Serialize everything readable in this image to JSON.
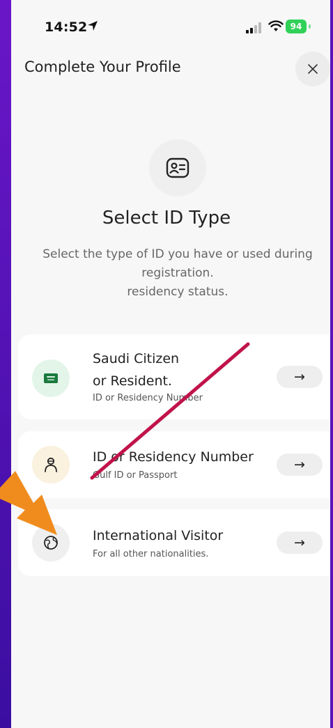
{
  "status_bar": {
    "time": "14:52",
    "battery": "94"
  },
  "header": {
    "title": "Complete Your Profile",
    "close_symbol": "✕"
  },
  "hero": {
    "title": "Select ID Type",
    "description_lines": [
      "Select the type of ID you have or used during",
      "registration.",
      "residency status."
    ]
  },
  "options": [
    {
      "title_line1": "Saudi Citizen",
      "title_line2": "or Resident.",
      "subtitle": "ID or Residency Number",
      "icon": "saudi-flag-icon",
      "arrow": "→"
    },
    {
      "title": "ID or Residency Number",
      "subtitle": "Gulf ID or Passport",
      "icon": "person-icon",
      "arrow": "→"
    },
    {
      "title": "International Visitor",
      "subtitle": "For all other nationalities.",
      "icon": "globe-icon",
      "arrow": "→"
    }
  ],
  "colors": {
    "accent_bg": "#4a12b0",
    "annotation_line": "#c0134a",
    "annotation_arrow": "#f08c1e",
    "battery": "#30d158"
  }
}
